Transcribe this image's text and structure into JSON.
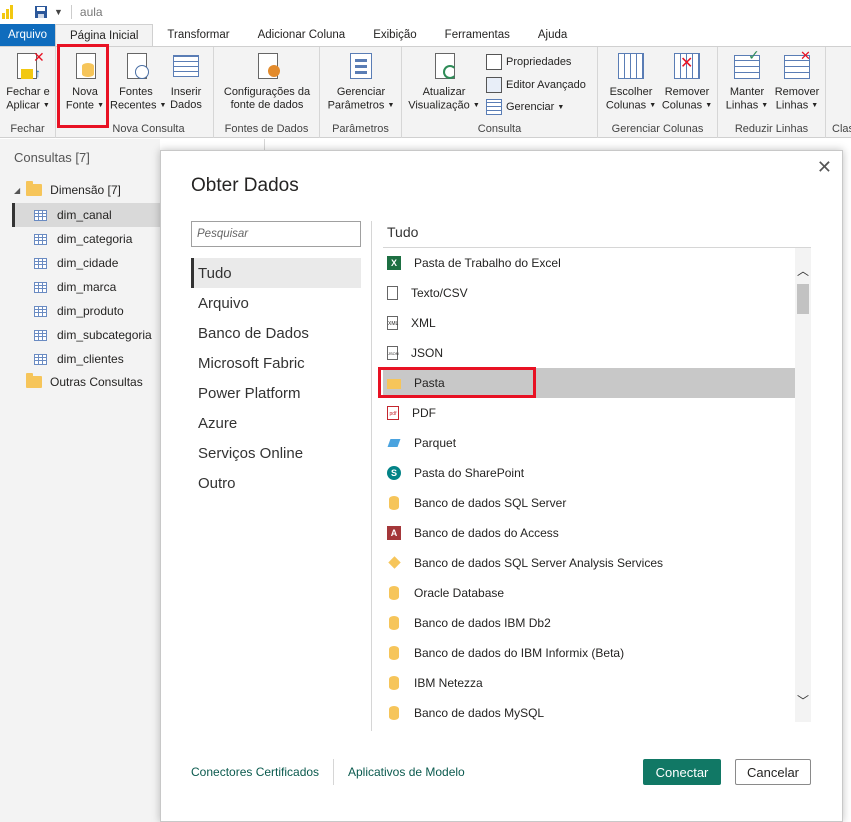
{
  "window": {
    "doc_title": "aula"
  },
  "tabs": [
    "Arquivo",
    "Página Inicial",
    "Transformar",
    "Adicionar Coluna",
    "Exibição",
    "Ferramentas",
    "Ajuda"
  ],
  "ribbon": {
    "fechar": {
      "btn1_line1": "Fechar e",
      "btn1_line2": "Aplicar",
      "group": "Fechar"
    },
    "nova_consulta": {
      "nova_line1": "Nova",
      "nova_line2": "Fonte",
      "fontes_line1": "Fontes",
      "fontes_line2": "Recentes",
      "inserir_line1": "Inserir",
      "inserir_line2": "Dados",
      "group": "Nova Consulta"
    },
    "fontes_dados": {
      "btn_line1": "Configurações da",
      "btn_line2": "fonte de dados",
      "group": "Fontes de Dados"
    },
    "parametros": {
      "btn_line1": "Gerenciar",
      "btn_line2": "Parâmetros",
      "group": "Parâmetros"
    },
    "consulta": {
      "atualizar_line1": "Atualizar",
      "atualizar_line2": "Visualização",
      "propriedades": "Propriedades",
      "editor": "Editor Avançado",
      "gerenciar": "Gerenciar",
      "group": "Consulta"
    },
    "gerenciar_colunas": {
      "escolher_line1": "Escolher",
      "escolher_line2": "Colunas",
      "remover_line1": "Remover",
      "remover_line2": "Colunas",
      "group": "Gerenciar Colunas"
    },
    "reduzir_linhas": {
      "manter_line1": "Manter",
      "manter_line2": "Linhas",
      "remover_line1": "Remover",
      "remover_line2": "Linhas",
      "group": "Reduzir Linhas"
    },
    "cut_group": "Clas"
  },
  "left_pane": {
    "header": "Consultas [7]",
    "folder1": "Dimensão [7]",
    "items": [
      "dim_canal",
      "dim_categoria",
      "dim_cidade",
      "dim_marca",
      "dim_produto",
      "dim_subcategoria",
      "dim_clientes"
    ],
    "folder2": "Outras Consultas"
  },
  "dialog": {
    "title": "Obter Dados",
    "search_placeholder": "Pesquisar",
    "categories": [
      "Tudo",
      "Arquivo",
      "Banco de Dados",
      "Microsoft Fabric",
      "Power Platform",
      "Azure",
      "Serviços Online",
      "Outro"
    ],
    "list_title": "Tudo",
    "items": [
      "Pasta de Trabalho do Excel",
      "Texto/CSV",
      "XML",
      "JSON",
      "Pasta",
      "PDF",
      "Parquet",
      "Pasta do SharePoint",
      "Banco de dados SQL Server",
      "Banco de dados do Access",
      "Banco de dados SQL Server Analysis Services",
      "Oracle Database",
      "Banco de dados IBM Db2",
      "Banco de dados do IBM Informix (Beta)",
      "IBM Netezza",
      "Banco de dados MySQL"
    ],
    "icons": {
      "xml": "XML",
      "json": "JSON",
      "pdf": "pdf"
    },
    "footer_link1": "Conectores Certificados",
    "footer_link2": "Aplicativos de Modelo",
    "connect": "Conectar",
    "cancel": "Cancelar"
  },
  "colors": {
    "accent": "#117865",
    "file_tab": "#0f6cbd",
    "highlight": "#e81123"
  }
}
